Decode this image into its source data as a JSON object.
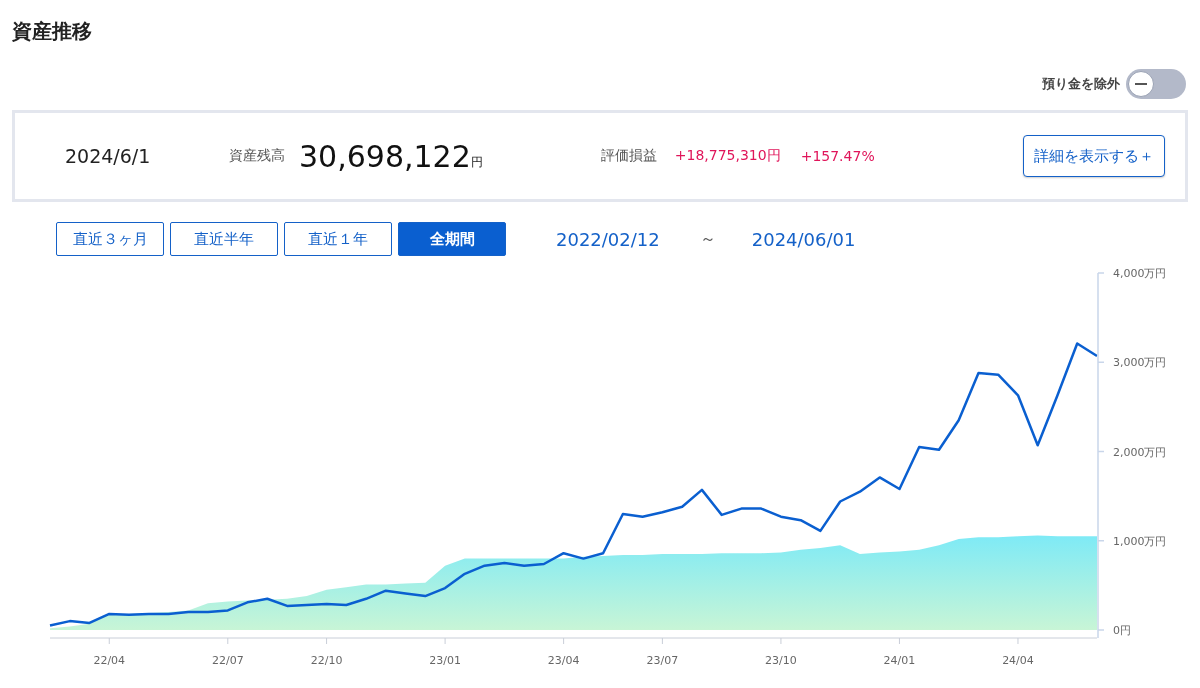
{
  "title": "資産推移",
  "toggle": {
    "label": "預り金を除外",
    "on": false
  },
  "summary": {
    "date": "2024/6/1",
    "balance_label": "資産残高",
    "balance": "30,698,122",
    "balance_unit": "円",
    "pl_label": "評価損益",
    "pl_amount": "+18,775,310円",
    "pl_percent": "+157.47%",
    "detail_button": "詳細を表示する＋"
  },
  "range_buttons": [
    {
      "label": "直近３ヶ月",
      "selected": false
    },
    {
      "label": "直近半年",
      "selected": false
    },
    {
      "label": "直近１年",
      "selected": false
    },
    {
      "label": "全期間",
      "selected": true
    }
  ],
  "period": {
    "from": "2022/02/12",
    "separator": "～",
    "to": "2024/06/01"
  },
  "chart": {
    "chart_data": {
      "type": "line",
      "categories": [
        null,
        null,
        null,
        "22/04",
        null,
        null,
        null,
        null,
        null,
        "22/07",
        null,
        null,
        null,
        null,
        "22/10",
        null,
        null,
        null,
        null,
        null,
        "23/01",
        null,
        null,
        null,
        null,
        null,
        "23/04",
        null,
        null,
        null,
        null,
        "23/07",
        null,
        null,
        null,
        null,
        null,
        "23/10",
        null,
        null,
        null,
        null,
        null,
        "24/01",
        null,
        null,
        null,
        null,
        null,
        "24/04",
        null,
        null,
        null,
        null
      ],
      "series": [
        {
          "type": "area",
          "color": "#7eeaf6",
          "values": [
            20,
            40,
            70,
            180,
            180,
            190,
            200,
            220,
            300,
            320,
            330,
            340,
            350,
            380,
            450,
            480,
            510,
            510,
            520,
            530,
            720,
            800,
            800,
            800,
            800,
            800,
            800,
            820,
            830,
            840,
            840,
            850,
            850,
            850,
            860,
            860,
            860,
            870,
            900,
            920,
            950,
            850,
            870,
            880,
            900,
            950,
            1020,
            1040,
            1040,
            1050,
            1060,
            1050,
            1050,
            1050
          ]
        },
        {
          "color": "#0a5fd0",
          "values": [
            50,
            100,
            80,
            180,
            170,
            180,
            180,
            200,
            200,
            220,
            310,
            350,
            270,
            280,
            290,
            280,
            350,
            440,
            410,
            380,
            470,
            630,
            720,
            750,
            720,
            740,
            860,
            800,
            860,
            1300,
            1270,
            1320,
            1380,
            1570,
            1290,
            1360,
            1360,
            1270,
            1230,
            1110,
            1440,
            1550,
            1710,
            1580,
            2050,
            2020,
            2350,
            2880,
            2860,
            2630,
            2070,
            2630,
            3210,
            3070
          ]
        }
      ],
      "ylim": [
        0,
        4000
      ],
      "yticks": [
        {
          "value": 0,
          "label": "0円"
        },
        {
          "value": 1000,
          "label": "1,000万円"
        },
        {
          "value": 2000,
          "label": "2,000万円"
        },
        {
          "value": 3000,
          "label": "3,000万円"
        },
        {
          "value": 4000,
          "label": "4,000万円"
        }
      ]
    }
  }
}
